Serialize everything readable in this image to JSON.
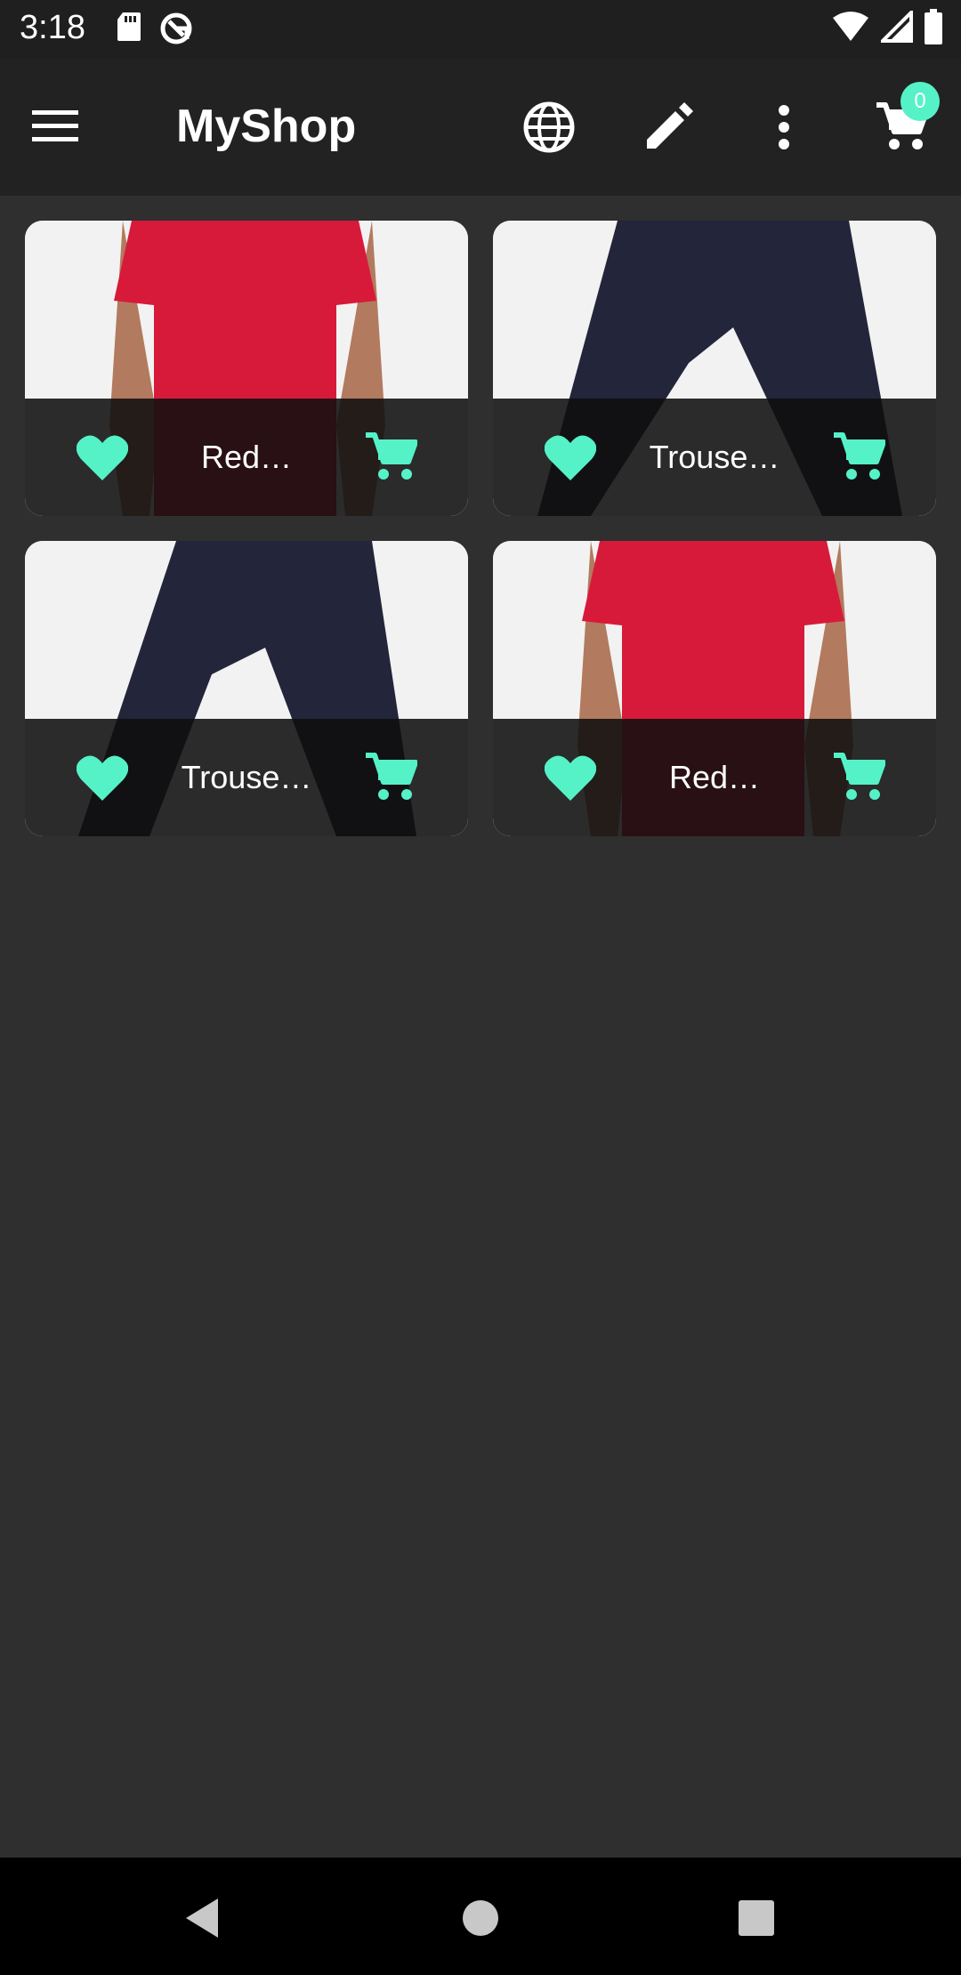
{
  "status": {
    "time": "3:18",
    "icons": [
      "sd-card-icon",
      "sync-icon",
      "wifi-icon",
      "signal-icon",
      "battery-icon"
    ]
  },
  "app_bar": {
    "title": "MyShop",
    "icons": [
      "menu-icon",
      "globe-icon",
      "edit-icon",
      "more-vert-icon",
      "cart-icon"
    ],
    "cart_count": "0"
  },
  "products": [
    {
      "name": "Red…",
      "image": "red-tshirt"
    },
    {
      "name": "Trouse…",
      "image": "navy-trousers"
    },
    {
      "name": "Trouse…",
      "image": "navy-trousers"
    },
    {
      "name": "Red…",
      "image": "red-tshirt"
    }
  ],
  "colors": {
    "accent": "#55f2c8",
    "background": "#2f2f2f",
    "app_bar": "#222222",
    "status_bar": "#1f1f1f",
    "nav_bar": "#000000"
  },
  "nav": [
    "back-icon",
    "home-icon",
    "recents-icon"
  ]
}
